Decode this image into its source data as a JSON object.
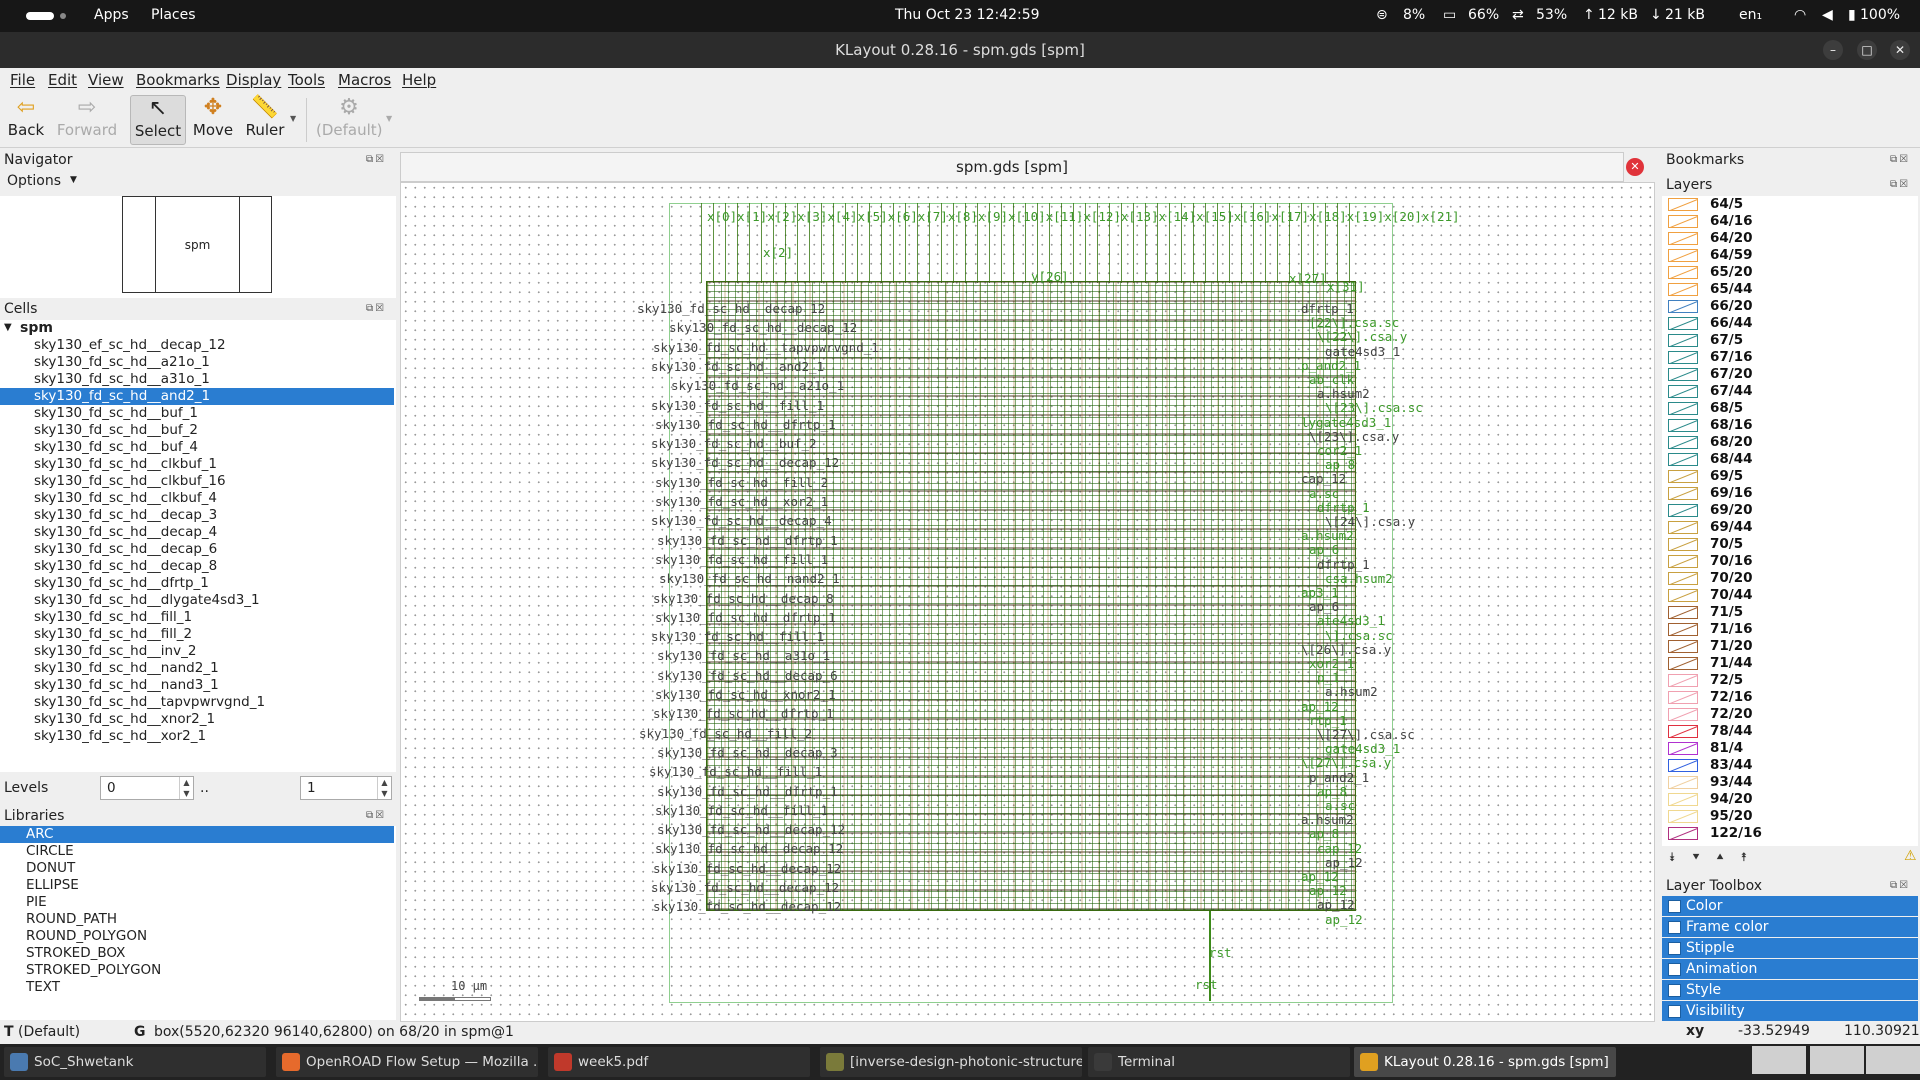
{
  "topbar": {
    "activities": "Apps",
    "places": "Places",
    "clock": "Thu Oct 23  12:42:59",
    "cpu": "8%",
    "memory": "66%",
    "network_load": "53%",
    "upload": "12 kB",
    "download": "21 kB",
    "keyboard_layout": "en₁",
    "battery": "100%"
  },
  "window": {
    "title": "KLayout 0.28.16 - spm.gds [spm]",
    "minimize": "–",
    "maximize": "□",
    "close": "✕"
  },
  "menu": [
    "File",
    "Edit",
    "View",
    "Bookmarks",
    "Display",
    "Tools",
    "Macros",
    "Help"
  ],
  "toolbar": {
    "back": "Back",
    "forward": "Forward",
    "select": "Select",
    "move": "Move",
    "ruler": "Ruler",
    "default": "(Default)"
  },
  "navigator": {
    "title": "Navigator",
    "options": "Options",
    "preview_label": "spm"
  },
  "cells": {
    "title": "Cells",
    "root": "spm",
    "items": [
      "sky130_ef_sc_hd__decap_12",
      "sky130_fd_sc_hd__a21o_1",
      "sky130_fd_sc_hd__a31o_1",
      "sky130_fd_sc_hd__and2_1",
      "sky130_fd_sc_hd__buf_1",
      "sky130_fd_sc_hd__buf_2",
      "sky130_fd_sc_hd__buf_4",
      "sky130_fd_sc_hd__clkbuf_1",
      "sky130_fd_sc_hd__clkbuf_16",
      "sky130_fd_sc_hd__clkbuf_4",
      "sky130_fd_sc_hd__decap_3",
      "sky130_fd_sc_hd__decap_4",
      "sky130_fd_sc_hd__decap_6",
      "sky130_fd_sc_hd__decap_8",
      "sky130_fd_sc_hd__dfrtp_1",
      "sky130_fd_sc_hd__dlygate4sd3_1",
      "sky130_fd_sc_hd__fill_1",
      "sky130_fd_sc_hd__fill_2",
      "sky130_fd_sc_hd__inv_2",
      "sky130_fd_sc_hd__nand2_1",
      "sky130_fd_sc_hd__nand3_1",
      "sky130_fd_sc_hd__tapvpwrvgnd_1",
      "sky130_fd_sc_hd__xnor2_1",
      "sky130_fd_sc_hd__xor2_1"
    ],
    "selected_index": 3
  },
  "levels": {
    "label": "Levels",
    "from": "0",
    "sep": "..",
    "to": "1"
  },
  "libraries": {
    "title": "Libraries",
    "items": [
      "ARC",
      "CIRCLE",
      "DONUT",
      "ELLIPSE",
      "PIE",
      "ROUND_PATH",
      "ROUND_POLYGON",
      "STROKED_BOX",
      "STROKED_POLYGON",
      "TEXT"
    ],
    "selected_index": 0
  },
  "canvas": {
    "tab_title": "spm.gds [spm]",
    "scale_label": "10 μm",
    "top_pins_label": "x[0]x[1]x[2]x[3]x[4]x[5]x[6]x[7]x[8]x[9]x[10]x[11]x[12]x[13]x[14]x[15]x[16]x[17]x[18]x[19]x[20]x[21]",
    "pin_x2": "x[2]",
    "pin_y": "y[26]",
    "pin_x27": "x[27]",
    "pin_x31": "x[31]",
    "pin_rst_1": "rst",
    "pin_rst_2": "rst",
    "left_labels": [
      "sky130_fd_sc_hd__decap_12",
      "sky130_fd_sc_hd__decap_12",
      "sky130_fd_sc_hd__tapvpwrvgnd_1",
      "sky130_fd_sc_hd__and2_1",
      "sky130_fd_sc_hd__a21o_1",
      "sky130_fd_sc_hd__fill_1",
      "sky130_fd_sc_hd__dfrtp_1",
      "sky130_fd_sc_hd__buf_2",
      "sky130_fd_sc_hd__decap_12",
      "sky130_fd_sc_hd__fill_2",
      "sky130_fd_sc_hd__xor2_1",
      "sky130_fd_sc_hd__decap_4",
      "sky130_fd_sc_hd__dfrtp_1",
      "sky130_fd_sc_hd__fill_1",
      "sky130_fd_sc_hd__nand2_1",
      "sky130_fd_sc_hd__decap_8",
      "sky130_fd_sc_hd__dfrtp_1",
      "sky130_fd_sc_hd__fill_1",
      "sky130_fd_sc_hd__a31o_1",
      "sky130_fd_sc_hd__decap_6",
      "sky130_fd_sc_hd__xnor2_1",
      "sky130_fd_sc_hd__dfrtp_1",
      "sky130_fd_sc_hd__fill_2",
      "sky130_fd_sc_hd__decap_3",
      "sky130_fd_sc_hd__fill_1",
      "sky130_fd_sc_hd__dfrtp_1",
      "sky130_fd_sc_hd__fill_1",
      "sky130_fd_sc_hd__decap_12",
      "sky130_fd_sc_hd__decap_12",
      "sky130_fd_sc_hd__decap_12",
      "sky130_fd_sc_hd__decap_12",
      "sky130_fd_sc_hd__decap_12"
    ],
    "right_labels": [
      "dfrtp_1",
      "[22\\].csa.sc",
      "\\[22\\].csa.y",
      "gate4sd3_1",
      "p_and2_1",
      "ab_clk",
      "a.hsum2",
      "\\[23\\].csa.sc",
      "lygate4sd3_1",
      "\\[23\\].csa.y",
      "cor2_1",
      "ap_8",
      "cap_12",
      "a.sc",
      "dfrtp_1",
      "\\[24\\].csa.y",
      "a.hsum2",
      "ap_6",
      "dfrtp_1",
      "csa.hsum2",
      "ap3_1",
      "ap_6",
      "ate4sd3_1",
      "\\].csa.sc",
      "\\[26\\].csa.y",
      "xor2_1",
      "p_1",
      "a.hsum2",
      "ap_12",
      "rtp_1",
      "\\[27\\].csa.sc",
      "gate4sd3_1",
      "\\[27\\].csa.y",
      "p_and2_1",
      "ap_8",
      "a.sc",
      "a.hsum2",
      "ap_8",
      "cap_12",
      "ap_12",
      "ap_12",
      "ap_12",
      "ap_12",
      "ap_12"
    ]
  },
  "bookmarks": {
    "title": "Bookmarks"
  },
  "layers": {
    "title": "Layers",
    "items": [
      {
        "name": "64/5",
        "color": "#f0a040"
      },
      {
        "name": "64/16",
        "color": "#f0a040"
      },
      {
        "name": "64/20",
        "color": "#f0a040"
      },
      {
        "name": "64/59",
        "color": "#f0a040"
      },
      {
        "name": "65/20",
        "color": "#f0a040"
      },
      {
        "name": "65/44",
        "color": "#f0a040"
      },
      {
        "name": "66/20",
        "color": "#4080c0"
      },
      {
        "name": "66/44",
        "color": "#2a8a8a"
      },
      {
        "name": "67/5",
        "color": "#2a8a8a"
      },
      {
        "name": "67/16",
        "color": "#2a8a8a"
      },
      {
        "name": "67/20",
        "color": "#2a8a8a"
      },
      {
        "name": "67/44",
        "color": "#2a8a8a"
      },
      {
        "name": "68/5",
        "color": "#2a8a8a"
      },
      {
        "name": "68/16",
        "color": "#2a8a8a"
      },
      {
        "name": "68/20",
        "color": "#2a8a8a"
      },
      {
        "name": "68/44",
        "color": "#2a8a8a"
      },
      {
        "name": "69/5",
        "color": "#c8a040"
      },
      {
        "name": "69/16",
        "color": "#c8a040"
      },
      {
        "name": "69/20",
        "color": "#2a8a8a"
      },
      {
        "name": "69/44",
        "color": "#c8a040"
      },
      {
        "name": "70/5",
        "color": "#c8a040"
      },
      {
        "name": "70/16",
        "color": "#c8a040"
      },
      {
        "name": "70/20",
        "color": "#c8a040"
      },
      {
        "name": "70/44",
        "color": "#c8a040"
      },
      {
        "name": "71/5",
        "color": "#a06030"
      },
      {
        "name": "71/16",
        "color": "#a06030"
      },
      {
        "name": "71/20",
        "color": "#a06030"
      },
      {
        "name": "71/44",
        "color": "#a06030"
      },
      {
        "name": "72/5",
        "color": "#f0a0b0"
      },
      {
        "name": "72/16",
        "color": "#f0a0b0"
      },
      {
        "name": "72/20",
        "color": "#f0a0b0"
      },
      {
        "name": "78/44",
        "color": "#e03040"
      },
      {
        "name": "81/4",
        "color": "#b030d0"
      },
      {
        "name": "83/44",
        "color": "#3060e0"
      },
      {
        "name": "93/44",
        "color": "#f0d0a0"
      },
      {
        "name": "94/20",
        "color": "#f0d890"
      },
      {
        "name": "95/20",
        "color": "#f0d890"
      },
      {
        "name": "122/16",
        "color": "#b03080"
      }
    ]
  },
  "layer_toolbox": {
    "title": "Layer Toolbox",
    "items": [
      "Color",
      "Frame color",
      "Stipple",
      "Animation",
      "Style",
      "Visibility"
    ]
  },
  "status": {
    "mode": "T",
    "mode_value": "(Default)",
    "g_label": "G",
    "g_value": "box(5520,62320 96140,62800) on 68/20 in spm@1",
    "xy_label": "xy",
    "x": "-33.52949",
    "y": "110.30921"
  },
  "taskbar": [
    {
      "label": "SoC_Shwetank",
      "color": "#4a7ab0"
    },
    {
      "label": "OpenROAD Flow Setup — Mozilla ...",
      "color": "#e66a2c"
    },
    {
      "label": "week5.pdf",
      "color": "#c0392b"
    },
    {
      "label": "[inverse-design-photonic-structure...",
      "color": "#7a7a3a"
    },
    {
      "label": "Terminal",
      "color": "#3a3a3a"
    },
    {
      "label": "KLayout 0.28.16 - spm.gds [spm]",
      "color": "#e0a020"
    }
  ]
}
